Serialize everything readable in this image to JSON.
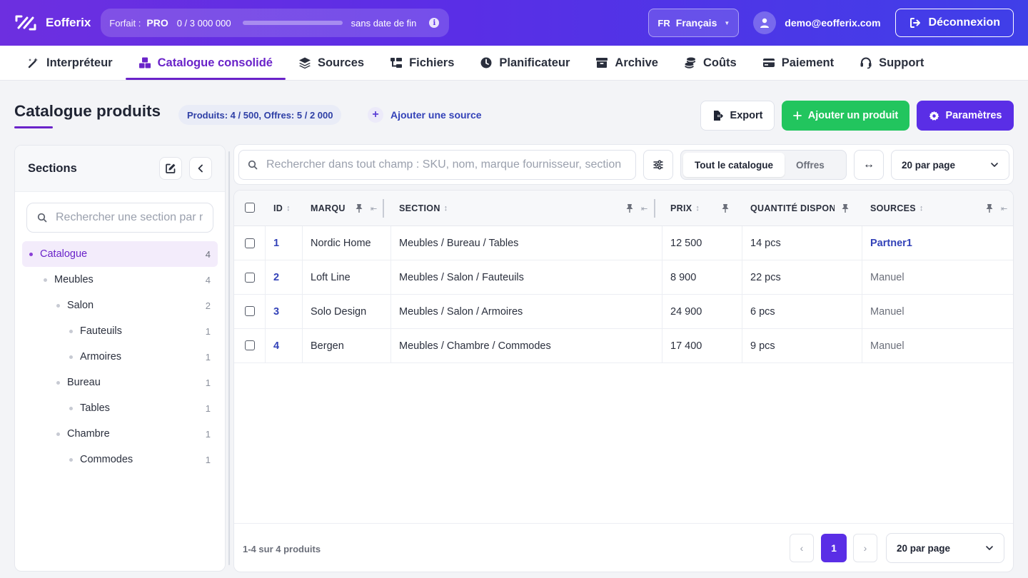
{
  "header": {
    "brand": "Eofferix",
    "plan_label": "Forfait :",
    "plan_tier": "PRO",
    "plan_usage": "0 / 3 000 000",
    "plan_usage_fraction": 0,
    "plan_expiry": "sans date de fin",
    "language_code": "FR",
    "language_name": "Français",
    "user_email": "demo@eofferix.com",
    "logout_label": "Déconnexion"
  },
  "nav": {
    "tabs": [
      {
        "label": "Interpréteur",
        "icon": "magic-wand-icon"
      },
      {
        "label": "Catalogue consolidé",
        "icon": "boxes-icon",
        "active": true
      },
      {
        "label": "Sources",
        "icon": "layers-icon"
      },
      {
        "label": "Fichiers",
        "icon": "folder-tree-icon"
      },
      {
        "label": "Planificateur",
        "icon": "clock-icon"
      },
      {
        "label": "Archive",
        "icon": "archive-box-icon"
      },
      {
        "label": "Coûts",
        "icon": "coins-icon"
      },
      {
        "label": "Paiement",
        "icon": "credit-card-icon"
      },
      {
        "label": "Support",
        "icon": "headset-icon"
      }
    ]
  },
  "page": {
    "title": "Catalogue produits",
    "counts": "Produits: 4 / 500, Offres: 5 / 2 000",
    "add_source": "Ajouter une source",
    "export_label": "Export",
    "add_product_label": "Ajouter un produit",
    "settings_label": "Paramètres"
  },
  "sidebar": {
    "title": "Sections",
    "search_placeholder": "Rechercher une section par nom",
    "tree": [
      {
        "label": "Catalogue",
        "count": "4",
        "level": 0,
        "active": true
      },
      {
        "label": "Meubles",
        "count": "4",
        "level": 1
      },
      {
        "label": "Salon",
        "count": "2",
        "level": 2
      },
      {
        "label": "Fauteuils",
        "count": "1",
        "level": 3
      },
      {
        "label": "Armoires",
        "count": "1",
        "level": 3
      },
      {
        "label": "Bureau",
        "count": "1",
        "level": 2
      },
      {
        "label": "Tables",
        "count": "1",
        "level": 3
      },
      {
        "label": "Chambre",
        "count": "1",
        "level": 2
      },
      {
        "label": "Commodes",
        "count": "1",
        "level": 3
      }
    ]
  },
  "toolbar": {
    "search_placeholder": "Rechercher dans tout champ : SKU, nom, marque fournisseur, section",
    "segments": [
      "Tout le catalogue",
      "Offres"
    ],
    "per_page": "20 par page"
  },
  "table": {
    "columns": [
      "ID",
      "MARQU",
      "SECTION",
      "PRIX",
      "QUANTITÉ DISPON",
      "SOURCES"
    ],
    "rows": [
      {
        "id": "1",
        "brand": "Nordic Home",
        "section": "Meubles / Bureau / Tables",
        "price": "12 500",
        "qty": "14 pcs",
        "source": "Partner1"
      },
      {
        "id": "2",
        "brand": "Loft Line",
        "section": "Meubles / Salon / Fauteuils",
        "price": "8 900",
        "qty": "22 pcs",
        "source": "Manuel"
      },
      {
        "id": "3",
        "brand": "Solo Design",
        "section": "Meubles / Salon / Armoires",
        "price": "24 900",
        "qty": "6 pcs",
        "source": "Manuel"
      },
      {
        "id": "4",
        "brand": "Bergen",
        "section": "Meubles / Chambre / Commodes",
        "price": "17 400",
        "qty": "9 pcs",
        "source": "Manuel"
      }
    ]
  },
  "footer": {
    "info": "1-4 sur 4 produits",
    "prev": "‹",
    "current_page": "1",
    "next": "›",
    "per_page": "20 par page"
  },
  "colors": {
    "accent": "#5a2ee6",
    "active_tab": "#6a23c9",
    "add_button": "#22c55e",
    "link": "#3342b8"
  }
}
